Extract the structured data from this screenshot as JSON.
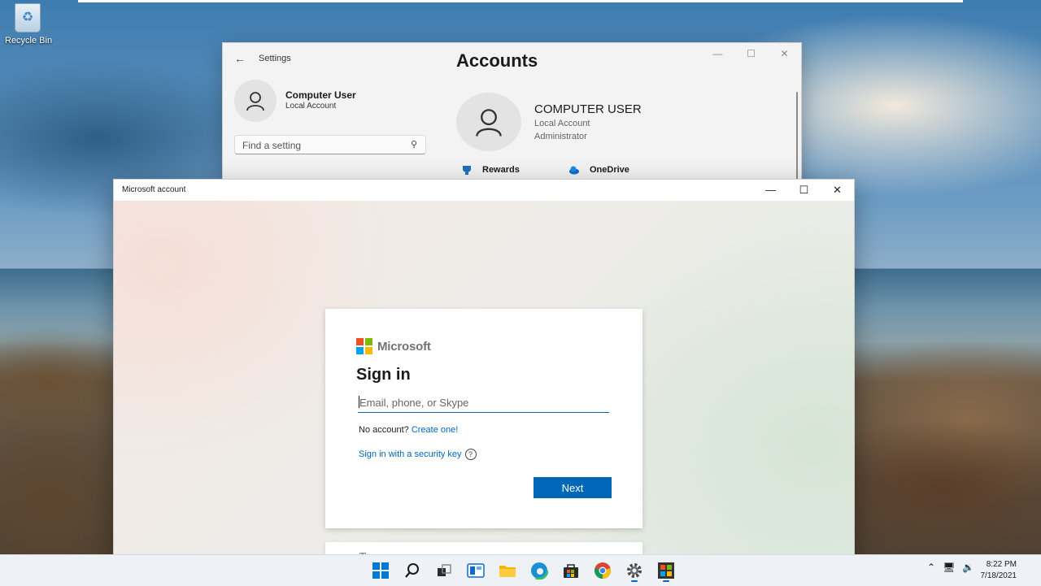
{
  "desktop": {
    "recycle_bin_label": "Recycle Bin"
  },
  "settings_window": {
    "title": "Settings",
    "user_name": "Computer User",
    "user_account_type": "Local Account",
    "search_placeholder": "Find a setting",
    "heading": "Accounts",
    "profile_name": "COMPUTER USER",
    "profile_line1": "Local Account",
    "profile_line2": "Administrator",
    "links": [
      {
        "label": "Rewards",
        "icon": "rewards-trophy-icon"
      },
      {
        "label": "OneDrive",
        "icon": "onedrive-cloud-icon"
      }
    ]
  },
  "msa_window": {
    "title": "Microsoft account",
    "brand": "Microsoft",
    "heading": "Sign in",
    "email_placeholder": "Email, phone, or Skype",
    "email_value": "",
    "no_account_text": "No account?",
    "create_link": "Create one!",
    "security_key_link": "Sign in with a security key",
    "next_button": "Next",
    "colors": {
      "accent": "#0067b8",
      "logo": [
        "#f25022",
        "#7fba00",
        "#00a4ef",
        "#ffb900"
      ]
    }
  },
  "taskbar": {
    "apps": [
      "windows-start-icon",
      "search-icon",
      "task-view-icon",
      "widgets-icon",
      "file-explorer-icon",
      "edge-browser-icon",
      "store-icon",
      "chrome-icon",
      "settings-gear-icon",
      "microsoft-account-app-icon"
    ],
    "time": "8:22 PM",
    "date": "7/18/2021"
  }
}
